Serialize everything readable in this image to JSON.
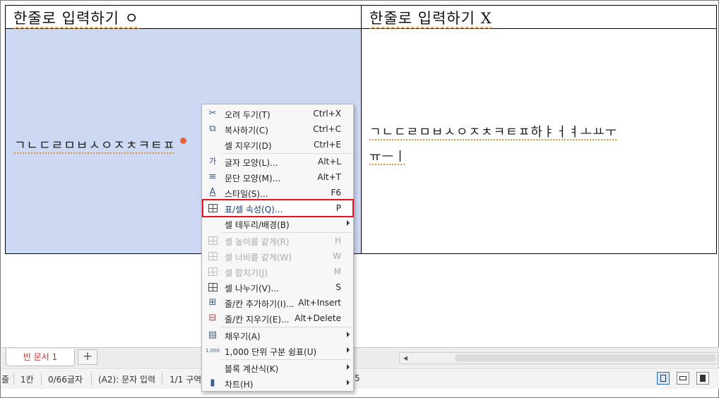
{
  "table": {
    "header_a": "한줄로 입력하기 ㅇ",
    "header_b": "한줄로 입력하기 X",
    "cell_a2_text": "ㄱㄴㄷㄹㅁㅂㅅㅇㅈㅊㅋㅌㅍ",
    "cell_b2_line1": "ㄱㄴㄷㄹㅁㅂㅅㅇㅈㅊㅋㅌㅍ하ㅑㅓㅕㅗㅛㅜ",
    "cell_b2_line2": "ㅠㅡㅣ"
  },
  "context_menu": {
    "items": [
      {
        "icon": "scissors-icon",
        "glyph": "✂",
        "label": "오려 두기(T)",
        "shortcut": "Ctrl+X",
        "enabled": true
      },
      {
        "icon": "copy-icon",
        "glyph": "⧉",
        "label": "복사하기(C)",
        "shortcut": "Ctrl+C",
        "enabled": true
      },
      {
        "icon": "",
        "glyph": "",
        "label": "셀 지우기(D)",
        "shortcut": "Ctrl+E",
        "enabled": true
      },
      {
        "icon": "char-shape-icon",
        "glyph": "가",
        "label": "글자 모양(L)...",
        "shortcut": "Alt+L",
        "enabled": true
      },
      {
        "icon": "paragraph-shape-icon",
        "glyph": "≡",
        "label": "문단 모양(M)...",
        "shortcut": "Alt+T",
        "enabled": true
      },
      {
        "icon": "style-icon",
        "glyph": "A",
        "label": "스타일(S)...",
        "shortcut": "F6",
        "enabled": true
      },
      {
        "icon": "table-props-icon",
        "glyph": "",
        "label": "표/셀 속성(Q)...",
        "shortcut": "P",
        "enabled": true,
        "highlighted": true
      },
      {
        "icon": "",
        "glyph": "",
        "label": "셀 테두리/배경(B)",
        "shortcut": "",
        "enabled": true,
        "submenu": true
      },
      {
        "icon": "equal-height-icon",
        "glyph": "",
        "label": "셀 높이를 같게(R)",
        "shortcut": "H",
        "enabled": false
      },
      {
        "icon": "equal-width-icon",
        "glyph": "",
        "label": "셀 너비를 같게(W)",
        "shortcut": "W",
        "enabled": false
      },
      {
        "icon": "merge-cells-icon",
        "glyph": "",
        "label": "셀 합치기(J)",
        "shortcut": "M",
        "enabled": false
      },
      {
        "icon": "split-cells-icon",
        "glyph": "",
        "label": "셀 나누기(V)...",
        "shortcut": "S",
        "enabled": true
      },
      {
        "icon": "insert-row-col-icon",
        "glyph": "⊞",
        "label": "줄/칸 추가하기(I)...",
        "shortcut": "Alt+Insert",
        "enabled": true
      },
      {
        "icon": "delete-row-col-icon",
        "glyph": "⊟",
        "label": "줄/칸 지우기(E)...",
        "shortcut": "Alt+Delete",
        "enabled": true
      },
      {
        "icon": "fill-icon",
        "glyph": "▤",
        "label": "채우기(A)",
        "shortcut": "",
        "enabled": true,
        "submenu": true
      },
      {
        "icon": "thousand-sep-icon",
        "glyph": "1,000",
        "label": "1,000 단위 구분 쉼표(U)",
        "shortcut": "",
        "enabled": true,
        "submenu": true
      },
      {
        "icon": "",
        "glyph": "",
        "label": "블록 계산식(K)",
        "shortcut": "",
        "enabled": true,
        "submenu": true
      },
      {
        "icon": "chart-icon",
        "glyph": "▮",
        "label": "차트(H)",
        "shortcut": "",
        "enabled": true,
        "submenu": true
      }
    ]
  },
  "tabs": {
    "doc_tab": "빈 문서 1",
    "add_tab": "+"
  },
  "status_bar": {
    "prefix": "줄",
    "column": "1칸",
    "char_count": "0/66글자",
    "cell_mode": "(A2): 문자 입력",
    "section": "1/1 구역",
    "trailing": "5"
  }
}
